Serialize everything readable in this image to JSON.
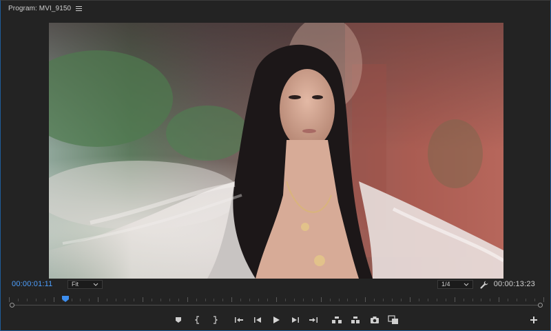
{
  "panel": {
    "title": "Program: MVI_9150",
    "menu_icon": "hamburger-menu-icon"
  },
  "timecode": {
    "current": "00:00:01:11",
    "duration": "00:00:13:23"
  },
  "zoom_select": {
    "selected": "Fit"
  },
  "resolution_select": {
    "selected": "1/4"
  },
  "settings_icon": "wrench-icon",
  "playhead_fraction": 0.104,
  "transport": {
    "buttons": [
      {
        "name": "add-marker-button",
        "icon": "marker-icon"
      },
      {
        "name": "mark-in-button",
        "icon": "mark-in-icon"
      },
      {
        "name": "mark-out-button",
        "icon": "mark-out-icon"
      },
      {
        "name": "go-to-in-button",
        "icon": "go-to-in-icon"
      },
      {
        "name": "step-back-button",
        "icon": "step-back-icon"
      },
      {
        "name": "play-button",
        "icon": "play-icon"
      },
      {
        "name": "step-forward-button",
        "icon": "step-forward-icon"
      },
      {
        "name": "go-to-out-button",
        "icon": "go-to-out-icon"
      },
      {
        "name": "lift-button",
        "icon": "lift-icon"
      },
      {
        "name": "extract-button",
        "icon": "extract-icon"
      },
      {
        "name": "export-frame-button",
        "icon": "camera-icon"
      },
      {
        "name": "comparison-view-button",
        "icon": "comparison-view-icon"
      }
    ]
  },
  "button_editor_icon": "plus-icon"
}
